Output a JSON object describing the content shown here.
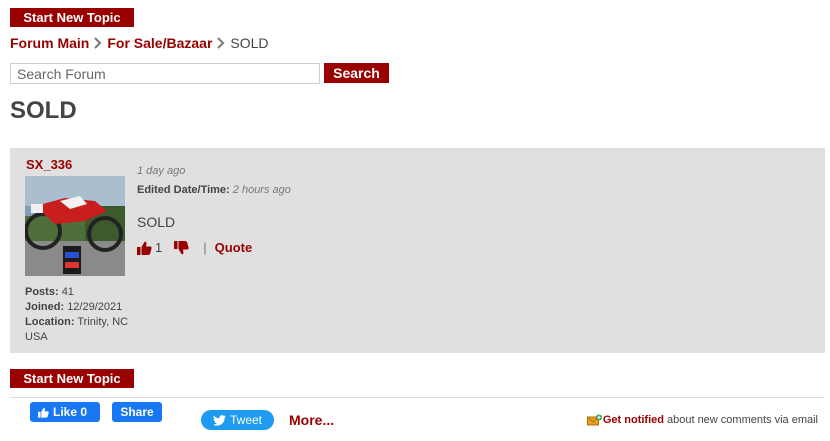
{
  "toolbar": {
    "new_topic_label": "Start New Topic"
  },
  "breadcrumb": {
    "items": [
      "Forum Main",
      "For Sale/Bazaar"
    ],
    "current": "SOLD"
  },
  "search": {
    "placeholder": "Search Forum",
    "button_label": "Search"
  },
  "page_title": "SOLD",
  "post": {
    "author": "SX_336",
    "posted": "1 day ago",
    "edited_label": "Edited Date/Time:",
    "edited_value": "2 hours ago",
    "body": "SOLD",
    "like_count": "1",
    "quote_label": "Quote",
    "stats": {
      "posts_label": "Posts:",
      "posts_value": "41",
      "joined_label": "Joined:",
      "joined_value": "12/29/2021",
      "location_label": "Location:",
      "location_value": "Trinity, NC USA"
    }
  },
  "social": {
    "fb_like_label": "Like 0",
    "fb_share_label": "Share",
    "tweet_label": "Tweet",
    "more_label": "More...",
    "notify_bold": "Get notified",
    "notify_rest": "about new comments via email"
  },
  "colors": {
    "accent": "#990000",
    "post_bg": "#e0e0e0",
    "facebook": "#1877f2",
    "twitter": "#1d9bf0"
  },
  "icons": [
    "chevron-right-icon",
    "thumbs-up-icon",
    "thumbs-down-icon",
    "twitter-bird-icon",
    "email-notify-icon"
  ]
}
